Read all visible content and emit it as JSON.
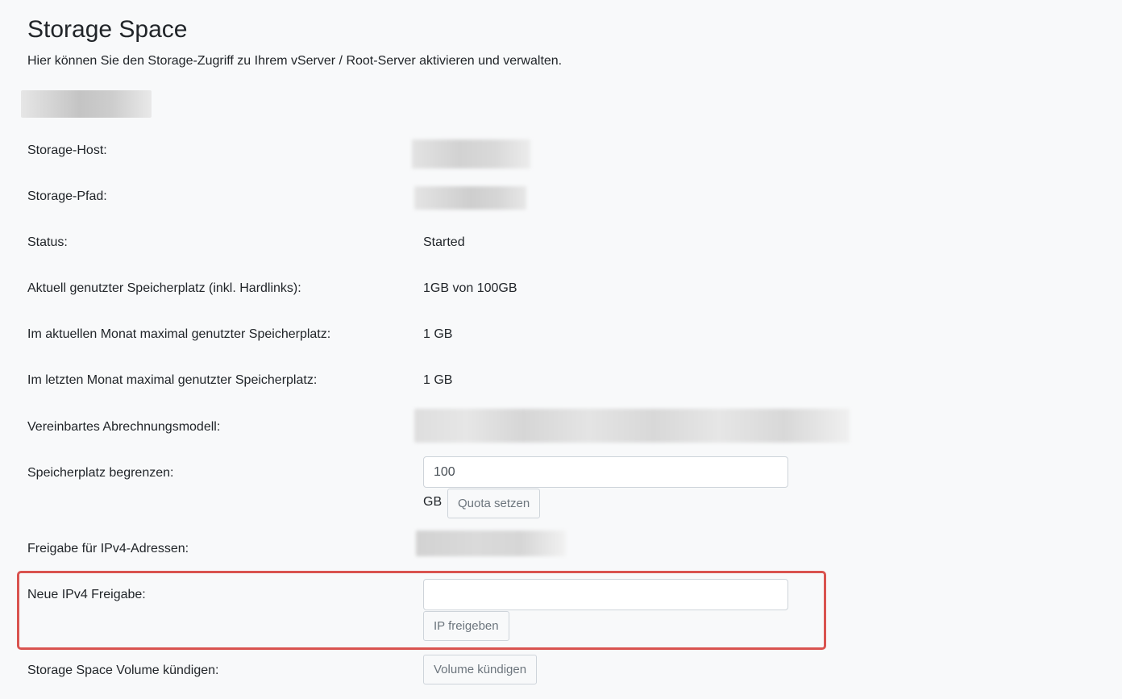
{
  "header": {
    "title": "Storage Space",
    "intro": "Hier können Sie den Storage-Zugriff zu Ihrem vServer / Root-Server aktivieren und verwalten."
  },
  "fields": {
    "host_label": "Storage-Host:",
    "path_label": "Storage-Pfad:",
    "status_label": "Status:",
    "status_value": "Started",
    "used_label": "Aktuell genutzter Speicherplatz (inkl. Hardlinks):",
    "used_value": "1GB von 100GB",
    "month_max_label": "Im aktuellen Monat maximal genutzter Speicherplatz:",
    "month_max_value": "1 GB",
    "last_month_label": "Im letzten Monat maximal genutzter Speicherplatz:",
    "last_month_value": "1 GB",
    "billing_label": "Vereinbartes Abrechnungsmodell:"
  },
  "quota": {
    "label": "Speicherplatz begrenzen:",
    "value": "100",
    "unit": "GB",
    "button": "Quota setzen"
  },
  "ipv4": {
    "list_label": "Freigabe für IPv4-Adressen:",
    "new_label": "Neue IPv4 Freigabe:",
    "new_value": "",
    "button": "IP freigeben"
  },
  "cancel": {
    "label": "Storage Space Volume kündigen:",
    "button": "Volume kündigen"
  },
  "colors": {
    "highlight_border": "#d9534f",
    "background": "#f8f9fa"
  }
}
